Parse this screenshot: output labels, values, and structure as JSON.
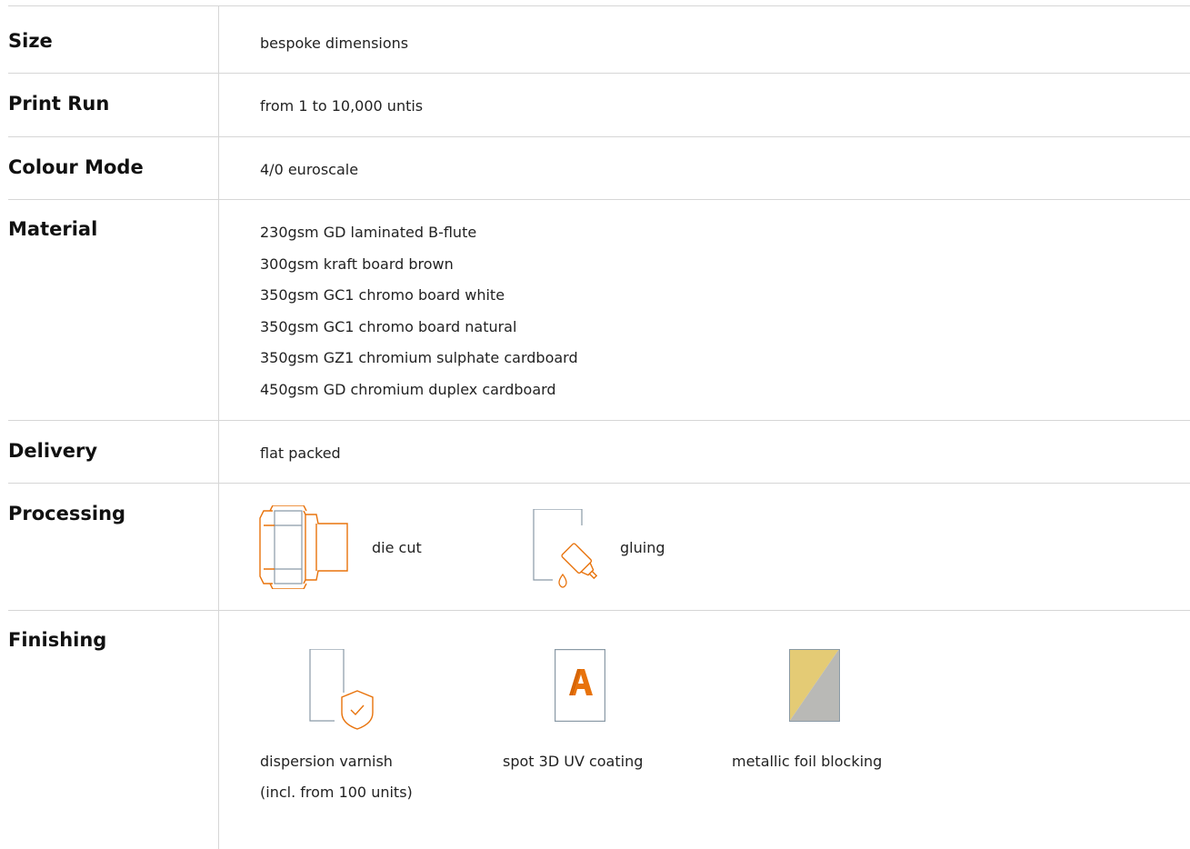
{
  "accent_color": "#e8730c",
  "outline_color": "#8a9aa6",
  "rows": {
    "size": {
      "label": "Size",
      "value": "bespoke dimensions"
    },
    "print_run": {
      "label": "Print Run",
      "value": "from 1 to 10,000 untis"
    },
    "colour_mode": {
      "label": "Colour Mode",
      "value": "4/0 euroscale"
    },
    "material": {
      "label": "Material",
      "items": [
        "230gsm GD laminated B-flute",
        "300gsm kraft board brown",
        "350gsm GC1 chromo board white",
        "350gsm GC1 chromo board natural",
        "350gsm GZ1 chromium sulphate cardboard",
        "450gsm GD chromium duplex cardboard"
      ]
    },
    "delivery": {
      "label": "Delivery",
      "value": "flat packed"
    },
    "processing": {
      "label": "Processing",
      "options": [
        {
          "label": "die cut",
          "icon": "box-dieline-icon"
        },
        {
          "label": "gluing",
          "icon": "glue-bottle-icon"
        }
      ]
    },
    "finishing": {
      "label": "Finishing",
      "options": [
        {
          "label_line1": "dispersion varnish",
          "label_line2": "(incl. from 100 units)",
          "icon": "shield-check-sheet-icon"
        },
        {
          "label_line1": "spot 3D UV coating",
          "icon": "letter-a-sheet-icon"
        },
        {
          "label_line1": "metallic foil blocking",
          "icon": "foil-sheet-icon"
        }
      ]
    }
  }
}
